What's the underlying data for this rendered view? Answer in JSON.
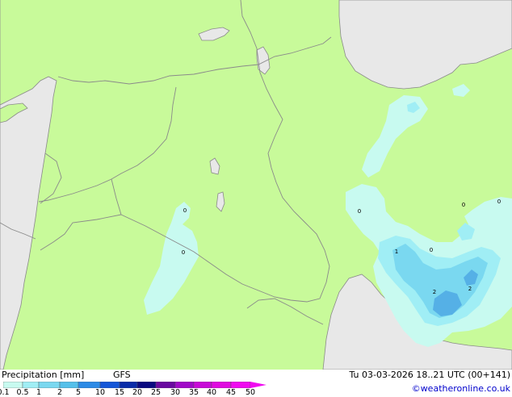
{
  "title": "Precipitation [mm]",
  "model": "GFS",
  "valid_time": "Tu 03-03-2026 18..21 UTC (00+141)",
  "credit": "©weatheronline.co.uk",
  "colors": {
    "land": "#c8fa9a",
    "sea": "#e8e8e8",
    "border": "#8a8a8a",
    "coast": "#8a8a8a",
    "precip_01": "#c8faf0",
    "precip_05": "#a0eef5",
    "precip_1": "#7ad8f0",
    "precip_2": "#55b0e6"
  },
  "legend": {
    "ticks": [
      "0.1",
      "0.5",
      "1",
      "2",
      "5",
      "10",
      "15",
      "20",
      "25",
      "30",
      "35",
      "40",
      "45",
      "50"
    ],
    "swatches": [
      "#c8faf0",
      "#a0eef5",
      "#7ad8f0",
      "#55c0ea",
      "#2c8ae6",
      "#1456d8",
      "#0a2ca8",
      "#0a0a80",
      "#6a0aa0",
      "#a00ac8",
      "#c80ad8",
      "#e00ae0",
      "#f00af0"
    ]
  },
  "point_values": [
    "0",
    "0",
    "0",
    "0",
    "0",
    "1",
    "0",
    "2",
    "2"
  ]
}
